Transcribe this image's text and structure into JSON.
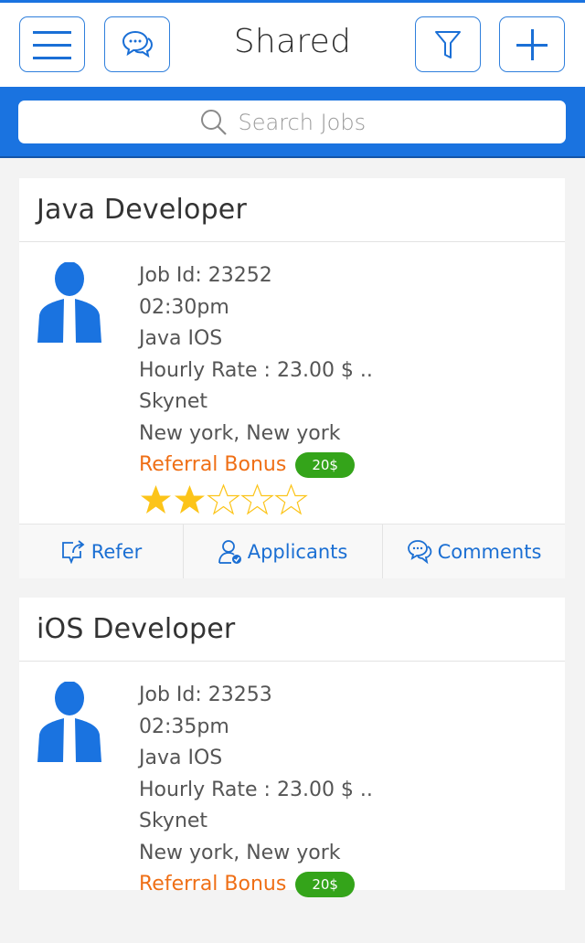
{
  "header": {
    "title": "Shared",
    "icons": [
      "menu-icon",
      "chat-icon",
      "filter-icon",
      "plus-icon"
    ]
  },
  "search": {
    "placeholder": "Search Jobs",
    "value": ""
  },
  "colors": {
    "accent": "#1a73e0",
    "bonus_text": "#ef6f16",
    "bonus_badge": "#34a41a",
    "star": "#fcc419"
  },
  "jobs": [
    {
      "title": "Java Developer",
      "job_id": "Job Id: 23252",
      "time": "02:30pm",
      "skills": "Java IOS",
      "rate": "Hourly Rate : 23.00 $ ..",
      "company": "Skynet",
      "location": "New york, New york",
      "bonus_label": "Referral Bonus",
      "bonus_value": "20$",
      "rating": 2,
      "rating_max": 5,
      "actions": {
        "refer": "Refer",
        "applicants": "Applicants",
        "comments": "Comments"
      }
    },
    {
      "title": "iOS Developer",
      "job_id": "Job Id: 23253",
      "time": "02:35pm",
      "skills": "Java IOS",
      "rate": "Hourly Rate : 23.00 $ ..",
      "company": "Skynet",
      "location": "New york, New york",
      "bonus_label": "Referral Bonus",
      "bonus_value": "20$"
    }
  ]
}
